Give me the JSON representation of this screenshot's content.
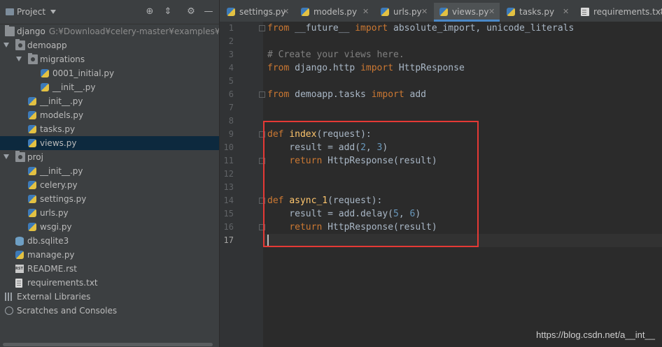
{
  "project_panel": {
    "title": "Project",
    "tree": [
      {
        "label": "django",
        "path": "G:¥Download¥celery-master¥examples¥django",
        "depth": 0,
        "type": "folder",
        "expanded": null
      },
      {
        "label": "demoapp",
        "depth": 0,
        "type": "folder",
        "expanded": true
      },
      {
        "label": "migrations",
        "depth": 1,
        "type": "folder",
        "expanded": true
      },
      {
        "label": "0001_initial.py",
        "depth": 2,
        "type": "py"
      },
      {
        "label": "__init__.py",
        "depth": 2,
        "type": "py"
      },
      {
        "label": "__init__.py",
        "depth": 1,
        "type": "py"
      },
      {
        "label": "models.py",
        "depth": 1,
        "type": "py"
      },
      {
        "label": "tasks.py",
        "depth": 1,
        "type": "py"
      },
      {
        "label": "views.py",
        "depth": 1,
        "type": "py",
        "selected": true
      },
      {
        "label": "proj",
        "depth": 0,
        "type": "folder",
        "expanded": true
      },
      {
        "label": "__init__.py",
        "depth": 1,
        "type": "py"
      },
      {
        "label": "celery.py",
        "depth": 1,
        "type": "py"
      },
      {
        "label": "settings.py",
        "depth": 1,
        "type": "py"
      },
      {
        "label": "urls.py",
        "depth": 1,
        "type": "py"
      },
      {
        "label": "wsgi.py",
        "depth": 1,
        "type": "py"
      },
      {
        "label": "db.sqlite3",
        "depth": 0,
        "type": "db"
      },
      {
        "label": "manage.py",
        "depth": 0,
        "type": "py"
      },
      {
        "label": "README.rst",
        "depth": 0,
        "type": "rst"
      },
      {
        "label": "requirements.txt",
        "depth": 0,
        "type": "txt"
      },
      {
        "label": "External Libraries",
        "depth": -1,
        "type": "lib"
      },
      {
        "label": "Scratches and Consoles",
        "depth": -1,
        "type": "scratch"
      }
    ]
  },
  "tabs": [
    {
      "label": "settings.py",
      "active": false
    },
    {
      "label": "models.py",
      "active": false
    },
    {
      "label": "urls.py",
      "active": false
    },
    {
      "label": "views.py",
      "active": true
    },
    {
      "label": "tasks.py",
      "active": false
    },
    {
      "label": "requirements.txt",
      "active": false
    }
  ],
  "editor": {
    "current_line": 17,
    "lines": [
      [
        [
          "kw",
          "from"
        ],
        [
          "t",
          " __future__ "
        ],
        [
          "kw",
          "import"
        ],
        [
          "t",
          " absolute_import, unicode_literals"
        ]
      ],
      [],
      [
        [
          "cm",
          "# Create your views here."
        ]
      ],
      [
        [
          "kw",
          "from"
        ],
        [
          "t",
          " django.http "
        ],
        [
          "kw",
          "import"
        ],
        [
          "t",
          " HttpResponse"
        ]
      ],
      [],
      [
        [
          "kw",
          "from"
        ],
        [
          "t",
          " demoapp.tasks "
        ],
        [
          "kw",
          "import"
        ],
        [
          "t",
          " add"
        ]
      ],
      [],
      [],
      [
        [
          "kw",
          "def"
        ],
        [
          "t",
          " "
        ],
        [
          "fn",
          "index"
        ],
        [
          "t",
          "(request):"
        ]
      ],
      [
        [
          "t",
          "    result = add("
        ],
        [
          "num",
          "2"
        ],
        [
          "t",
          ", "
        ],
        [
          "num",
          "3"
        ],
        [
          "t",
          ")"
        ]
      ],
      [
        [
          "t",
          "    "
        ],
        [
          "kw",
          "return"
        ],
        [
          "t",
          " HttpResponse(result)"
        ]
      ],
      [],
      [],
      [
        [
          "kw",
          "def"
        ],
        [
          "t",
          " "
        ],
        [
          "fn",
          "async_1"
        ],
        [
          "t",
          "(request):"
        ]
      ],
      [
        [
          "t",
          "    result = add.delay("
        ],
        [
          "num",
          "5"
        ],
        [
          "t",
          ", "
        ],
        [
          "num",
          "6"
        ],
        [
          "t",
          ")"
        ]
      ],
      [
        [
          "t",
          "    "
        ],
        [
          "kw",
          "return"
        ],
        [
          "t",
          " HttpResponse(result)"
        ]
      ],
      []
    ]
  },
  "watermark": "https://blog.csdn.net/a__int__",
  "colors": {
    "accent": "#4a88c7",
    "highlight_box": "#e53935",
    "keyword": "#cc7832",
    "function": "#ffc66d",
    "number": "#6897bb",
    "comment": "#808080"
  }
}
